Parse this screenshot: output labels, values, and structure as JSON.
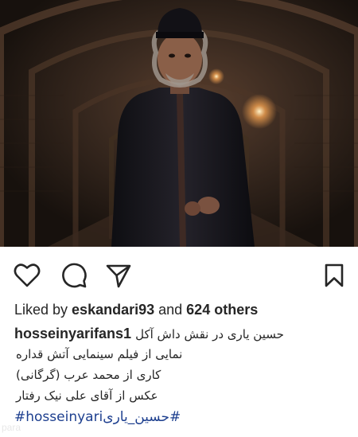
{
  "post": {
    "photo_alt": "photo",
    "actions": {
      "like_icon": "heart-icon",
      "comment_icon": "speech-bubble-icon",
      "share_icon": "paper-plane-icon",
      "save_icon": "bookmark-icon"
    },
    "likes": {
      "prefix": "Liked by ",
      "user": "eskandari93",
      "middle": " and ",
      "others": "624 others"
    },
    "caption": {
      "username": "hosseinyarifans1",
      "lines": [
        "حسین یاری در نقش داش آکل",
        "نمایی از فیلم سینمایی آتش قداره",
        "کاری از محمد عرب (گرگانی)",
        "عکس از آقای علی نیک رفتار"
      ],
      "hashtags": [
        "#hosseinyari",
        "#حسین_یاری"
      ]
    },
    "watermark": "para"
  },
  "colors": {
    "text": "#262626",
    "hashtag": "#1d3f8f",
    "icon_stroke": "#262626"
  }
}
